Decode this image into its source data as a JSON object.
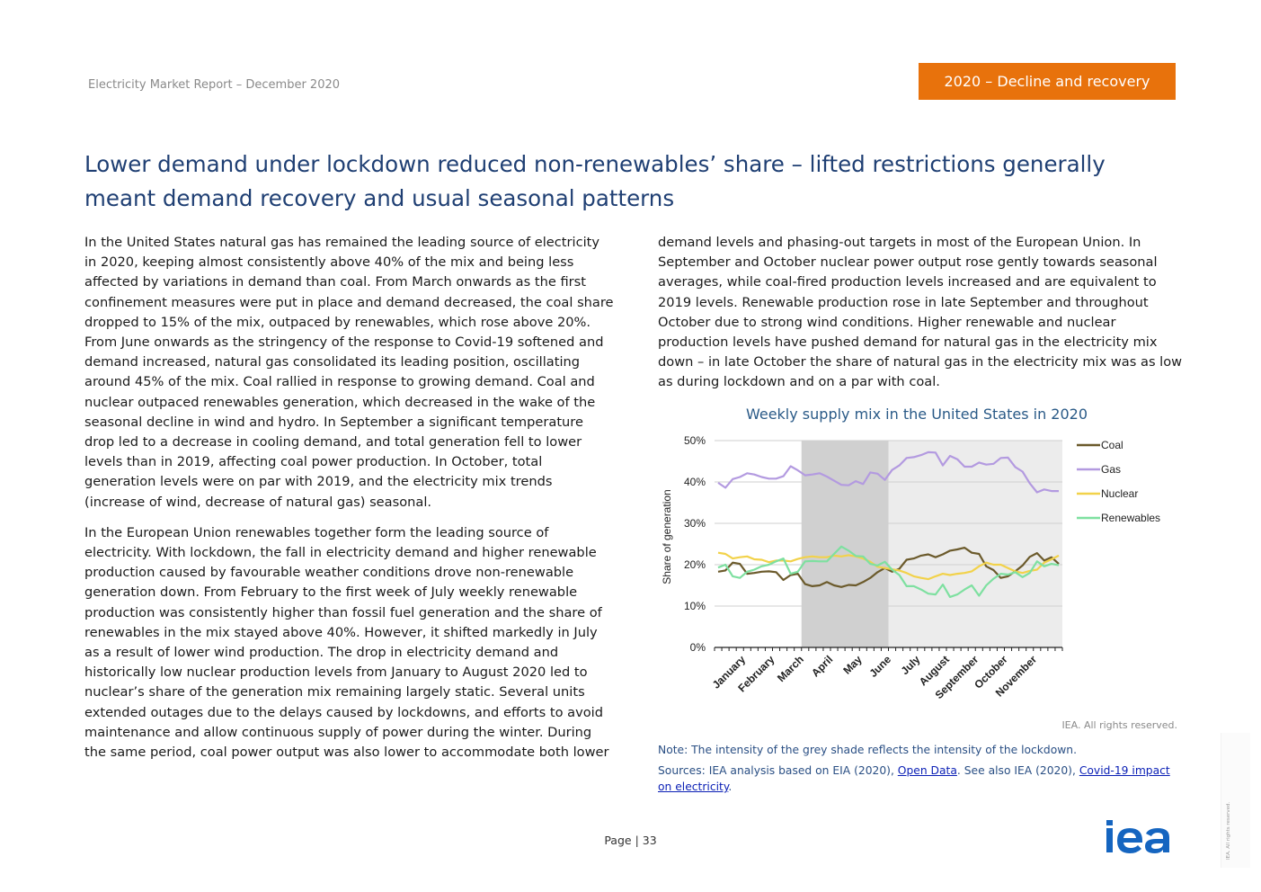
{
  "header": {
    "report": "Electricity Market Report – December 2020",
    "section": "2020 – Decline and recovery"
  },
  "title": "Lower demand under lockdown reduced non-renewables’ share – lifted restrictions generally meant demand recovery and usual seasonal patterns",
  "body": {
    "p1": "In the United States natural gas has remained the leading source of electricity in 2020, keeping almost consistently above 40% of the mix and being less affected by variations in demand than coal. From March onwards as the first confinement measures were put in place and demand decreased, the coal share dropped to 15% of the mix, outpaced by renewables, which rose above 20%. From June onwards as the stringency of the response to Covid-19 softened and demand increased, natural gas consolidated its leading position, oscillating around 45% of the mix. Coal rallied in response to growing demand. Coal and nuclear outpaced renewables generation, which decreased in the wake of the seasonal decline in wind and hydro. In September a significant temperature drop led to a decrease in cooling demand, and total generation fell to lower levels than in 2019, affecting coal power production. In October, total generation levels were on par with 2019, and the electricity mix trends (increase of wind, decrease of natural gas) seasonal.",
    "p2": "In the European Union renewables together form the leading source of electricity. With lockdown, the fall in electricity demand and higher renewable production caused by favourable weather conditions drove non-renewable generation down. From February to the first week of July weekly renewable production was consistently higher than fossil fuel generation and the share of renewables in the mix stayed above 40%. However, it shifted markedly in July as a result of lower wind production. The drop in electricity demand and historically low nuclear production levels from January to August 2020 led to nuclear’s share of the generation mix remaining largely static. Several units extended outages due to the delays caused by lockdowns, and efforts to avoid maintenance and allow continuous supply of power during the winter. During the same period, coal power output was also lower to accommodate both lower",
    "p3": "demand levels and phasing-out targets in most of the European Union. In September and October nuclear power output rose gently towards seasonal averages, while coal-fired production levels increased and are equivalent to 2019 levels. Renewable production rose in late September and throughout October due to strong wind conditions. Higher renewable and nuclear production levels have pushed demand for natural gas in the electricity mix down – in late October the share of natural gas in the electricity mix was as low as during lockdown and on a par with coal."
  },
  "chart_data": {
    "type": "line",
    "title": "Weekly supply mix in the United States in 2020",
    "ylabel": "Share of generation",
    "xlabel": "",
    "ylim": [
      0,
      0.5
    ],
    "y_ticks": [
      "0%",
      "10%",
      "20%",
      "30%",
      "40%",
      "50%"
    ],
    "month_labels": [
      "January",
      "February",
      "March",
      "April",
      "May",
      "June",
      "July",
      "August",
      "September",
      "October",
      "November"
    ],
    "weeks": 48,
    "x": [
      1,
      2,
      3,
      4,
      5,
      6,
      7,
      8,
      9,
      10,
      11,
      12,
      13,
      14,
      15,
      16,
      17,
      18,
      19,
      20,
      21,
      22,
      23,
      24,
      25,
      26,
      27,
      28,
      29,
      30,
      31,
      32,
      33,
      34,
      35,
      36,
      37,
      38,
      39,
      40,
      41,
      42,
      43,
      44,
      45,
      46,
      47,
      48
    ],
    "shading": [
      {
        "from_week": 12,
        "to_week": 24,
        "intensity": "high"
      },
      {
        "from_week": 24,
        "to_week": 48,
        "intensity": "low"
      }
    ],
    "grid": true,
    "legend_position": "right",
    "series": [
      {
        "name": "Coal",
        "color": "#6b5a2b",
        "values": [
          0.183,
          0.186,
          0.205,
          0.202,
          0.178,
          0.18,
          0.183,
          0.184,
          0.182,
          0.163,
          0.175,
          0.178,
          0.153,
          0.148,
          0.15,
          0.158,
          0.15,
          0.146,
          0.151,
          0.15,
          0.158,
          0.168,
          0.182,
          0.192,
          0.183,
          0.19,
          0.212,
          0.215,
          0.222,
          0.225,
          0.218,
          0.225,
          0.234,
          0.237,
          0.241,
          0.229,
          0.226,
          0.196,
          0.187,
          0.168,
          0.172,
          0.184,
          0.198,
          0.219,
          0.228,
          0.21,
          0.218,
          0.202
        ]
      },
      {
        "name": "Gas",
        "color": "#b39ae0",
        "values": [
          0.398,
          0.386,
          0.407,
          0.412,
          0.421,
          0.418,
          0.412,
          0.408,
          0.408,
          0.414,
          0.438,
          0.428,
          0.416,
          0.418,
          0.421,
          0.413,
          0.403,
          0.393,
          0.392,
          0.402,
          0.395,
          0.423,
          0.42,
          0.405,
          0.429,
          0.44,
          0.458,
          0.46,
          0.465,
          0.472,
          0.471,
          0.44,
          0.463,
          0.455,
          0.437,
          0.437,
          0.447,
          0.442,
          0.444,
          0.458,
          0.459,
          0.436,
          0.425,
          0.397,
          0.375,
          0.382,
          0.378,
          0.378
        ]
      },
      {
        "name": "Nuclear",
        "color": "#f2d24a",
        "values": [
          0.229,
          0.226,
          0.215,
          0.218,
          0.22,
          0.213,
          0.212,
          0.206,
          0.21,
          0.21,
          0.208,
          0.214,
          0.218,
          0.22,
          0.218,
          0.218,
          0.222,
          0.22,
          0.223,
          0.22,
          0.215,
          0.207,
          0.195,
          0.192,
          0.189,
          0.186,
          0.18,
          0.172,
          0.168,
          0.165,
          0.172,
          0.178,
          0.175,
          0.178,
          0.18,
          0.184,
          0.196,
          0.205,
          0.2,
          0.2,
          0.192,
          0.184,
          0.18,
          0.185,
          0.188,
          0.205,
          0.213,
          0.222
        ]
      },
      {
        "name": "Renewables",
        "color": "#7ee0a0",
        "values": [
          0.193,
          0.2,
          0.172,
          0.168,
          0.183,
          0.188,
          0.196,
          0.2,
          0.208,
          0.215,
          0.178,
          0.183,
          0.208,
          0.209,
          0.208,
          0.208,
          0.226,
          0.244,
          0.234,
          0.221,
          0.22,
          0.202,
          0.198,
          0.207,
          0.188,
          0.175,
          0.148,
          0.148,
          0.14,
          0.13,
          0.128,
          0.152,
          0.122,
          0.128,
          0.14,
          0.15,
          0.125,
          0.15,
          0.166,
          0.178,
          0.176,
          0.182,
          0.17,
          0.18,
          0.208,
          0.196,
          0.202,
          0.199
        ]
      }
    ]
  },
  "chart_footer": {
    "rights": "IEA. All rights reserved.",
    "note": "Note: The intensity of the grey shade reflects the intensity of the lockdown.",
    "sources_prefix": "Sources: IEA analysis based on EIA (2020), ",
    "link1": "Open Data",
    "sources_middle": ". See also IEA (2020), ",
    "link2": "Covid-19 impact on electricity",
    "sources_suffix": "."
  },
  "footer": {
    "page_label": "Page | 33",
    "logo": "iea",
    "side_note": "IEA. All rights reserved."
  },
  "colors": {
    "accent_orange": "#e8720c",
    "title_blue": "#1f3f73",
    "logo_blue": "#1565c0"
  }
}
